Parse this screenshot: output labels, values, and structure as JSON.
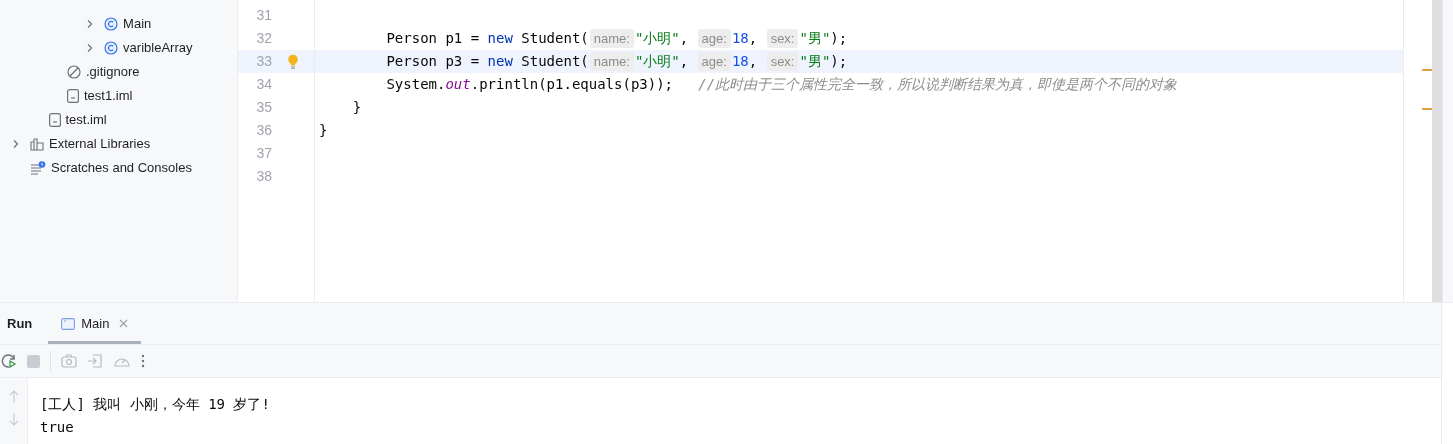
{
  "project_tree": [
    {
      "children": [
        {
          "children": [
            {
              "children": [
                {
                  "label": "Main",
                  "kind": "class",
                  "expanded": false
                },
                {
                  "label": "varibleArray",
                  "kind": "class",
                  "expanded": false
                }
              ]
            },
            {
              "label": ".gitignore",
              "kind": "ignore"
            },
            {
              "label": "test1.iml",
              "kind": "file"
            }
          ]
        },
        {
          "label": "test.iml",
          "kind": "file"
        }
      ]
    },
    {
      "label": "External Libraries",
      "kind": "library",
      "expanded": false
    },
    {
      "label": "Scratches and Consoles",
      "kind": "scratches"
    }
  ],
  "editor": {
    "lines": [
      {
        "number": "31",
        "highlighted": false
      },
      {
        "number": "32",
        "highlighted": false,
        "tokens": [
          {
            "kind": "plain",
            "text": "        Person p1 = "
          },
          {
            "kind": "keyword",
            "text": "new"
          },
          {
            "kind": "plain",
            "text": " Student("
          },
          {
            "kind": "hint",
            "text": "name:"
          },
          {
            "kind": "string",
            "text": "\"小明\""
          },
          {
            "kind": "plain",
            "text": ", "
          },
          {
            "kind": "hint",
            "text": "age:"
          },
          {
            "kind": "number",
            "text": "18"
          },
          {
            "kind": "plain",
            "text": ", "
          },
          {
            "kind": "hint",
            "text": "sex:"
          },
          {
            "kind": "string",
            "text": "\"男\""
          },
          {
            "kind": "plain",
            "text": ");"
          }
        ]
      },
      {
        "number": "33",
        "highlighted": true,
        "bulb": true,
        "tokens": [
          {
            "kind": "plain",
            "text": "        Person p3 = "
          },
          {
            "kind": "keyword",
            "text": "new"
          },
          {
            "kind": "plain",
            "text": " Student("
          },
          {
            "kind": "hint",
            "text": "name:"
          },
          {
            "kind": "string",
            "text": "\"小明\""
          },
          {
            "kind": "plain",
            "text": ", "
          },
          {
            "kind": "hint",
            "text": "age:"
          },
          {
            "kind": "number",
            "text": "18"
          },
          {
            "kind": "plain",
            "text": ", "
          },
          {
            "kind": "hint",
            "text": "sex:"
          },
          {
            "kind": "string",
            "text": "\"男\""
          },
          {
            "kind": "plain",
            "text": ");"
          }
        ]
      },
      {
        "number": "34",
        "highlighted": false,
        "tokens": [
          {
            "kind": "plain",
            "text": "        System."
          },
          {
            "kind": "field",
            "text": "out"
          },
          {
            "kind": "plain",
            "text": ".println(p1.equals(p3));   "
          },
          {
            "kind": "comment",
            "text": "//此时由于三个属性完全一致，所以说判断结果为真，即使是两个不同的对象"
          }
        ]
      },
      {
        "number": "35",
        "highlighted": false,
        "tokens": [
          {
            "kind": "plain",
            "text": "    }"
          }
        ]
      },
      {
        "number": "36",
        "highlighted": false,
        "tokens": [
          {
            "kind": "plain",
            "text": "}"
          }
        ]
      },
      {
        "number": "37",
        "highlighted": false
      },
      {
        "number": "38",
        "highlighted": false
      }
    ]
  },
  "run_panel": {
    "title": "Run",
    "tabs": [
      {
        "label": "Main",
        "selected": true
      }
    ],
    "console": [
      "[工人] 我叫 小刚，今年 19 岁了!",
      "true"
    ]
  }
}
